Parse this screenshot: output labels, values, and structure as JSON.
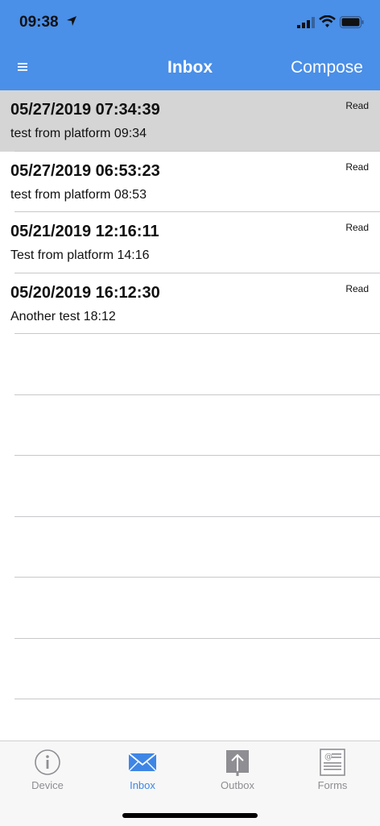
{
  "status_bar": {
    "time": "09:38"
  },
  "nav": {
    "menu_icon": "hamburger-menu-icon",
    "title": "Inbox",
    "compose_label": "Compose"
  },
  "messages": [
    {
      "date": "05/27/2019 07:34:39",
      "subject": "test from platform 09:34",
      "status": "Read",
      "selected": true
    },
    {
      "date": "05/27/2019 06:53:23",
      "subject": "test from platform 08:53",
      "status": "Read",
      "selected": false
    },
    {
      "date": "05/21/2019 12:16:11",
      "subject": "Test from platform 14:16",
      "status": "Read",
      "selected": false
    },
    {
      "date": "05/20/2019 16:12:30",
      "subject": "Another test 18:12",
      "status": "Read",
      "selected": false
    }
  ],
  "tabs": [
    {
      "label": "Device",
      "icon": "info-circle-icon",
      "active": false
    },
    {
      "label": "Inbox",
      "icon": "envelope-icon",
      "active": true
    },
    {
      "label": "Outbox",
      "icon": "upload-arrow-icon",
      "active": false
    },
    {
      "label": "Forms",
      "icon": "form-document-icon",
      "active": false
    }
  ],
  "colors": {
    "header": "#4a8fe8",
    "active_tab": "#3e86e6",
    "inactive_tab": "#8e8e93",
    "selected_row": "#d5d5d5"
  }
}
